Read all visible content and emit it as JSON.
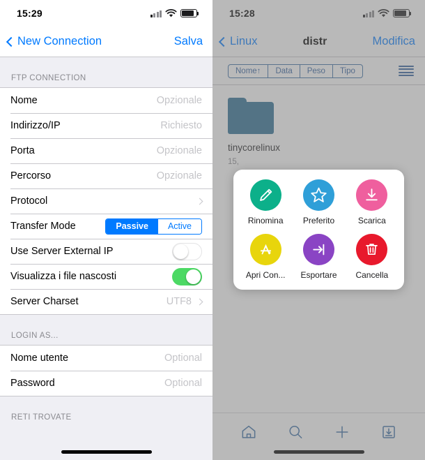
{
  "left": {
    "status": {
      "time": "15:29",
      "signal_icon": "cellular-bars-icon",
      "wifi_icon": "wifi-icon",
      "battery_icon": "battery-icon"
    },
    "nav": {
      "back_label": "New Connection",
      "back_icon": "chevron-left-icon",
      "action_label": "Salva"
    },
    "sections": [
      {
        "header": "FTP CONNECTION",
        "rows": [
          {
            "label": "Nome",
            "value": "Opzionale",
            "type": "text"
          },
          {
            "label": "Indirizzo/IP",
            "value": "Richiesto",
            "type": "text"
          },
          {
            "label": "Porta",
            "value": "Opzionale",
            "type": "text"
          },
          {
            "label": "Percorso",
            "value": "Opzionale",
            "type": "text"
          },
          {
            "label": "Protocol",
            "value": "",
            "type": "disclosure"
          },
          {
            "label": "Transfer Mode",
            "type": "segmented",
            "options": [
              "Passive",
              "Active"
            ],
            "selected": "Passive"
          },
          {
            "label": "Use Server External IP",
            "type": "toggle",
            "on": false
          },
          {
            "label": "Visualizza i file nascosti",
            "type": "toggle",
            "on": true
          },
          {
            "label": "Server Charset",
            "value": "UTF8",
            "type": "disclosure"
          }
        ]
      },
      {
        "header": "LOGIN AS...",
        "rows": [
          {
            "label": "Nome utente",
            "value": "Optional",
            "type": "text"
          },
          {
            "label": "Password",
            "value": "Optional",
            "type": "text"
          }
        ]
      },
      {
        "header": "RETI TROVATE",
        "rows": []
      }
    ]
  },
  "right": {
    "status": {
      "time": "15:28",
      "signal_icon": "cellular-bars-icon",
      "wifi_icon": "wifi-icon",
      "battery_icon": "battery-icon"
    },
    "nav": {
      "back_label": "Linux",
      "back_icon": "chevron-left-icon",
      "title": "distr",
      "action_label": "Modifica"
    },
    "sort_tabs": [
      {
        "label": "Nome↑",
        "active": true
      },
      {
        "label": "Data",
        "active": false
      },
      {
        "label": "Peso",
        "active": false
      },
      {
        "label": "Tipo",
        "active": false
      }
    ],
    "menu_icon": "hamburger-menu-icon",
    "file": {
      "name": "tinycorelinux",
      "sub": "15,",
      "icon": "folder-icon"
    },
    "popup": {
      "actions": [
        {
          "label": "Rinomina",
          "icon": "pencil-icon",
          "color": "#0cb08a"
        },
        {
          "label": "Preferito",
          "icon": "star-icon",
          "color": "#2f9fd8"
        },
        {
          "label": "Scarica",
          "icon": "download-icon",
          "color": "#ef5f9e"
        },
        {
          "label": "Apri Con...",
          "icon": "appstore-icon",
          "color": "#e8d50c"
        },
        {
          "label": "Esportare",
          "icon": "export-arrow-icon",
          "color": "#8a44c4"
        },
        {
          "label": "Cancella",
          "icon": "trash-icon",
          "color": "#e8192c"
        }
      ]
    },
    "toolbar": [
      {
        "icon": "home-icon",
        "name": "home-button"
      },
      {
        "icon": "search-icon",
        "name": "search-button"
      },
      {
        "icon": "plus-icon",
        "name": "add-button"
      },
      {
        "icon": "download-box-icon",
        "name": "downloads-button"
      }
    ]
  },
  "colors": {
    "accent": "#007aff",
    "toggle_on": "#4cd964",
    "folder": "#2a6d93",
    "toolbar_icon": "#3a6ea5"
  }
}
